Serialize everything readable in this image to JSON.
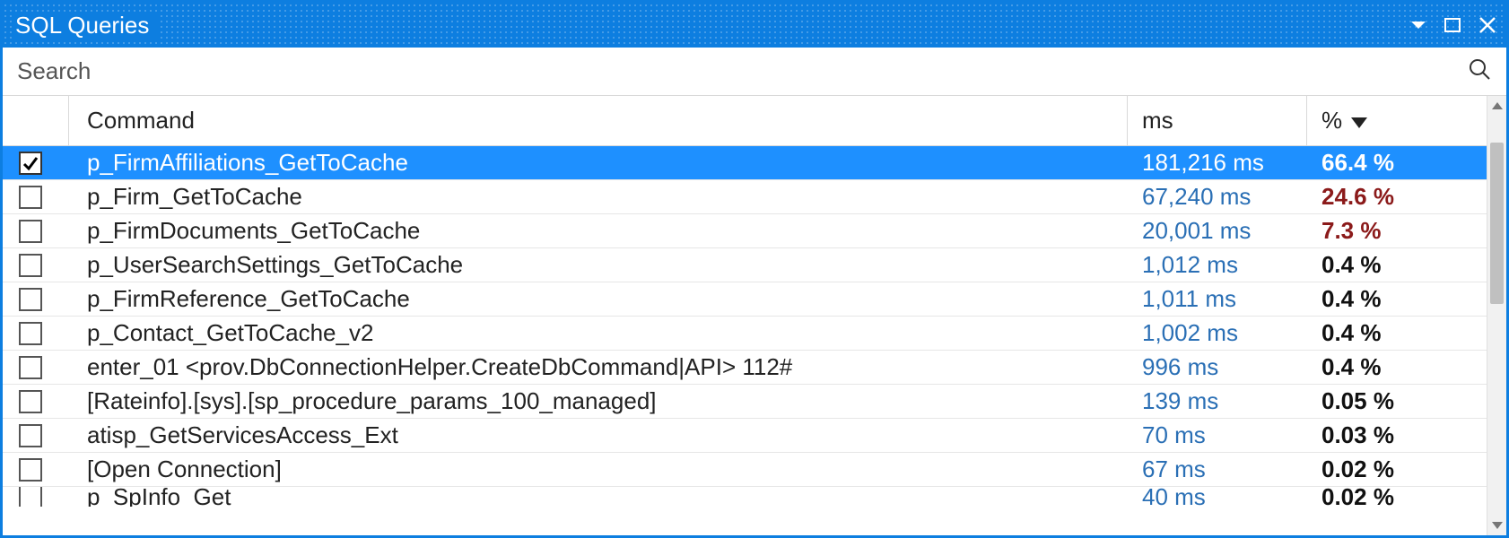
{
  "window": {
    "title": "SQL Queries"
  },
  "search": {
    "placeholder": "Search"
  },
  "columns": {
    "command": "Command",
    "ms": "ms",
    "pct": "%"
  },
  "sort": {
    "column": "pct",
    "direction": "desc"
  },
  "rows": [
    {
      "checked": true,
      "selected": true,
      "command": "p_FirmAffiliations_GetToCache",
      "ms": "181,216 ms",
      "pct": "66.4 %",
      "hot": false
    },
    {
      "checked": false,
      "selected": false,
      "command": "p_Firm_GetToCache",
      "ms": "67,240 ms",
      "pct": "24.6 %",
      "hot": true
    },
    {
      "checked": false,
      "selected": false,
      "command": "p_FirmDocuments_GetToCache",
      "ms": "20,001 ms",
      "pct": "7.3 %",
      "hot": true
    },
    {
      "checked": false,
      "selected": false,
      "command": "p_UserSearchSettings_GetToCache",
      "ms": "1,012 ms",
      "pct": "0.4 %",
      "hot": false
    },
    {
      "checked": false,
      "selected": false,
      "command": "p_FirmReference_GetToCache",
      "ms": "1,011 ms",
      "pct": "0.4 %",
      "hot": false
    },
    {
      "checked": false,
      "selected": false,
      "command": "p_Contact_GetToCache_v2",
      "ms": "1,002 ms",
      "pct": "0.4 %",
      "hot": false
    },
    {
      "checked": false,
      "selected": false,
      "command": "enter_01 <prov.DbConnectionHelper.CreateDbCommand|API> 112#",
      "ms": "996 ms",
      "pct": "0.4 %",
      "hot": false
    },
    {
      "checked": false,
      "selected": false,
      "command": "[Rateinfo].[sys].[sp_procedure_params_100_managed]",
      "ms": "139 ms",
      "pct": "0.05 %",
      "hot": false
    },
    {
      "checked": false,
      "selected": false,
      "command": "atisp_GetServicesAccess_Ext",
      "ms": "70 ms",
      "pct": "0.03 %",
      "hot": false
    },
    {
      "checked": false,
      "selected": false,
      "command": "[Open Connection]",
      "ms": "67 ms",
      "pct": "0.02 %",
      "hot": false
    },
    {
      "checked": false,
      "selected": false,
      "command": "p_SpInfo_Get",
      "ms": "40 ms",
      "pct": "0.02 %",
      "hot": false,
      "cutoff": true
    }
  ]
}
